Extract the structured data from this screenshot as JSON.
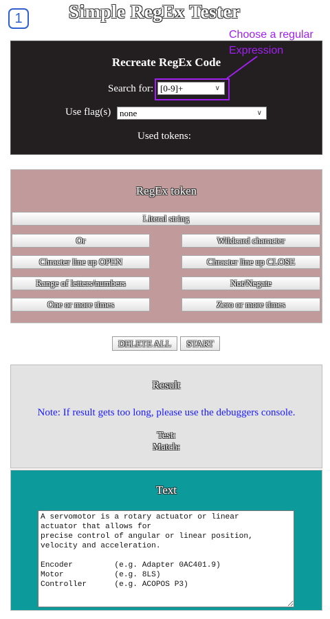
{
  "step_badge": "1",
  "app_title": "Simple RegEx Tester",
  "callout": {
    "line1": "Choose a regular",
    "line2": "Expression",
    "color": "#a020f0"
  },
  "recreate": {
    "heading": "Recreate RegEx Code",
    "search_label": "Search for:",
    "search_value": "[0-9]+",
    "flags_label": "Use flag(s)",
    "flags_value": "none",
    "used_tokens_label": "Used tokens:"
  },
  "tokens": {
    "heading": "RegEx token",
    "literal": "Literal string",
    "or": "Or",
    "wildcard": "Wildcard character",
    "char_open": "Chracter line up OPEN",
    "char_close": "Chracter line up CLOSE",
    "range": "Range of letters/numbers",
    "not_negate": "Not/Negate",
    "one_or_more": "One or more times",
    "zero_or_more": "Zero or more times"
  },
  "controls": {
    "delete_all": "DELETE ALL",
    "start": "START"
  },
  "result": {
    "heading": "Result",
    "note": "Note: If result gets too long, please use the debuggers console.",
    "test_label": "Test:",
    "match_label": "Match:"
  },
  "text_section": {
    "heading": "Text",
    "content": "A servomotor is a rotary actuator or linear\nactuator that allows for\nprecise control of angular or linear position,\nvelocity and acceleration.\n\nEncoder         (e.g. Adapter 0AC401.9)\nMotor           (e.g. 8LS)\nController      (e.g. ACOPOS P3)"
  },
  "colors": {
    "recreate_bg": "#231f20",
    "tokens_bg": "#c19b9b",
    "result_bg": "#e3e3e3",
    "text_bg": "#0d9a9a",
    "note_text": "#1a1aff",
    "badge_border": "#2f5fd0"
  }
}
